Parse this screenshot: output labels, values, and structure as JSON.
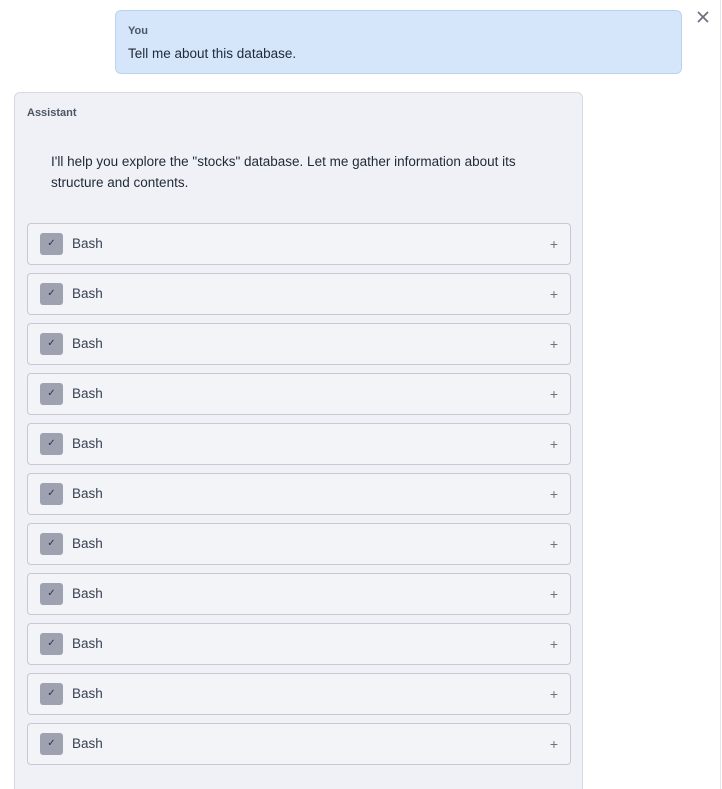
{
  "user_message": {
    "role": "You",
    "text": "Tell me about this database."
  },
  "close_icon": "close-icon",
  "assistant_message": {
    "role": "Assistant",
    "text": "I'll help you explore the \"stocks\" database. Let me gather information about its structure and contents."
  },
  "tool_calls": [
    {
      "label": "Bash",
      "status": "completed",
      "check_glyph": "✓",
      "expand_glyph": "+"
    },
    {
      "label": "Bash",
      "status": "completed",
      "check_glyph": "✓",
      "expand_glyph": "+"
    },
    {
      "label": "Bash",
      "status": "completed",
      "check_glyph": "✓",
      "expand_glyph": "+"
    },
    {
      "label": "Bash",
      "status": "completed",
      "check_glyph": "✓",
      "expand_glyph": "+"
    },
    {
      "label": "Bash",
      "status": "completed",
      "check_glyph": "✓",
      "expand_glyph": "+"
    },
    {
      "label": "Bash",
      "status": "completed",
      "check_glyph": "✓",
      "expand_glyph": "+"
    },
    {
      "label": "Bash",
      "status": "completed",
      "check_glyph": "✓",
      "expand_glyph": "+"
    },
    {
      "label": "Bash",
      "status": "completed",
      "check_glyph": "✓",
      "expand_glyph": "+"
    },
    {
      "label": "Bash",
      "status": "completed",
      "check_glyph": "✓",
      "expand_glyph": "+"
    },
    {
      "label": "Bash",
      "status": "completed",
      "check_glyph": "✓",
      "expand_glyph": "+"
    },
    {
      "label": "Bash",
      "status": "completed",
      "check_glyph": "✓",
      "expand_glyph": "+"
    }
  ],
  "colors": {
    "user_bubble": "#d5e6fb",
    "assistant_bubble": "#f0f1f7",
    "check_badge": "#9ea2b0"
  }
}
